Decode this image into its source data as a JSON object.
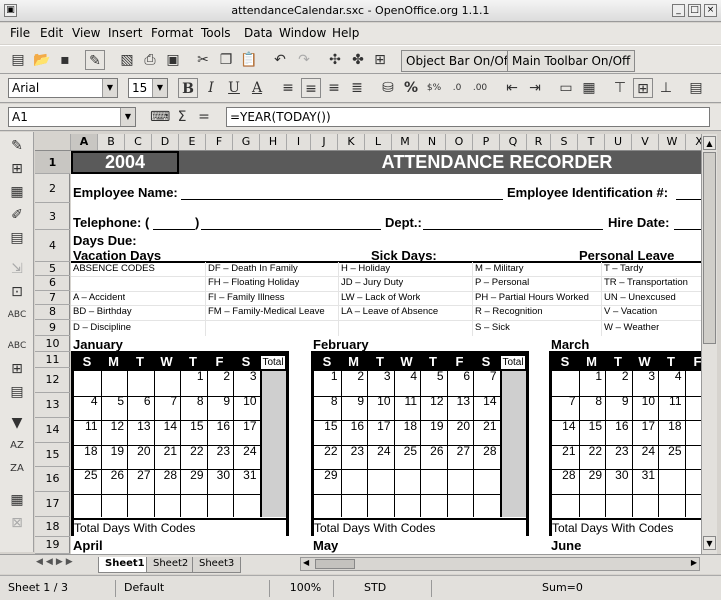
{
  "window": {
    "title": "attendanceCalendar.sxc - OpenOffice.org 1.1.1"
  },
  "menu": [
    "File",
    "Edit",
    "View",
    "Insert",
    "Format",
    "Tools",
    "Data",
    "Window",
    "Help"
  ],
  "toolbar": {
    "object_bar_toggle": "Object Bar On/Off",
    "main_toolbar_toggle": "Main Toolbar On/Off"
  },
  "format": {
    "font_name": "Arial",
    "font_size": "15"
  },
  "formula": {
    "cell_ref": "A1",
    "content": "=YEAR(TODAY())",
    "sum_symbol": "Σ",
    "equals_symbol": "="
  },
  "columns": [
    "A",
    "B",
    "C",
    "D",
    "E",
    "F",
    "G",
    "H",
    "I",
    "J",
    "K",
    "L",
    "M",
    "N",
    "O",
    "P",
    "Q",
    "R",
    "S",
    "T",
    "U",
    "V",
    "W",
    "X"
  ],
  "rows": [
    "1",
    "2",
    "3",
    "4",
    "5",
    "6",
    "7",
    "8",
    "9",
    "10",
    "11",
    "12",
    "13",
    "14",
    "15",
    "16",
    "17",
    "18",
    "19"
  ],
  "sheet": {
    "year": "2004",
    "heading": "ATTENDANCE RECORDER",
    "employee_name": "Employee Name:",
    "employee_id": "Employee Identification #:",
    "telephone": "Telephone: (",
    "telephone_close": ")",
    "dept": "Dept.:",
    "hire_date": "Hire Date:",
    "days_due": "Days Due:",
    "vacation_days": "Vacation Days",
    "sick_days": "Sick Days:",
    "personal_leave": "Personal Leave",
    "codes": [
      [
        "ABSENCE CODES",
        "DF – Death In Family",
        "H – Holiday",
        "M – Military",
        "T – Tardy"
      ],
      [
        "",
        "FH – Floating Holiday",
        "JD – Jury Duty",
        "P – Personal",
        "TR – Transportation"
      ],
      [
        "A   – Accident",
        "FI  – Family Illness",
        "LW – Lack of Work",
        "PH – Partial Hours Worked",
        "UN – Unexcused"
      ],
      [
        "BD – Birthday",
        "FM – Family-Medical Leave",
        "LA – Leave of Absence",
        "R – Recognition",
        "V – Vacation"
      ],
      [
        "D   – Discipline",
        "",
        "",
        "S – Sick",
        "W – Weather"
      ]
    ],
    "weekday_letters": [
      "S",
      "M",
      "T",
      "W",
      "T",
      "F",
      "S"
    ],
    "total_label": "Total",
    "total_codes": "Total Days With Codes",
    "months": [
      {
        "name": "January",
        "weeks": [
          [
            "",
            "",
            "",
            "",
            "1",
            "2",
            "3"
          ],
          [
            "4",
            "5",
            "6",
            "7",
            "8",
            "9",
            "10"
          ],
          [
            "11",
            "12",
            "13",
            "14",
            "15",
            "16",
            "17"
          ],
          [
            "18",
            "19",
            "20",
            "21",
            "22",
            "23",
            "24"
          ],
          [
            "25",
            "26",
            "27",
            "28",
            "29",
            "30",
            "31"
          ],
          [
            "",
            "",
            "",
            "",
            "",
            "",
            ""
          ]
        ]
      },
      {
        "name": "February",
        "weeks": [
          [
            "",
            "1",
            "2",
            "3",
            "4",
            "5",
            "6",
            "7"
          ],
          [
            "8",
            "9",
            "10",
            "11",
            "12",
            "13",
            "14"
          ],
          [
            "15",
            "16",
            "17",
            "18",
            "19",
            "20",
            "21"
          ],
          [
            "22",
            "23",
            "24",
            "25",
            "26",
            "27",
            "28"
          ],
          [
            "29",
            "",
            "",
            "",
            "",
            "",
            ""
          ],
          [
            "",
            "",
            "",
            "",
            "",
            "",
            ""
          ]
        ]
      },
      {
        "name": "March",
        "weeks": [
          [
            "",
            "1",
            "2",
            "3",
            "4"
          ],
          [
            "7",
            "8",
            "9",
            "10",
            "11"
          ],
          [
            "14",
            "15",
            "16",
            "17",
            "18"
          ],
          [
            "21",
            "22",
            "23",
            "24",
            "25"
          ],
          [
            "28",
            "29",
            "30",
            "31",
            ""
          ],
          [
            "",
            "",
            "",
            "",
            ""
          ]
        ]
      }
    ],
    "next_months": [
      "April",
      "May",
      "June"
    ]
  },
  "tabs": [
    "Sheet1",
    "Sheet2",
    "Sheet3"
  ],
  "status": {
    "sheet": "Sheet 1 / 3",
    "style": "Default",
    "zoom": "100%",
    "mode": "STD",
    "sum": "Sum=0"
  }
}
